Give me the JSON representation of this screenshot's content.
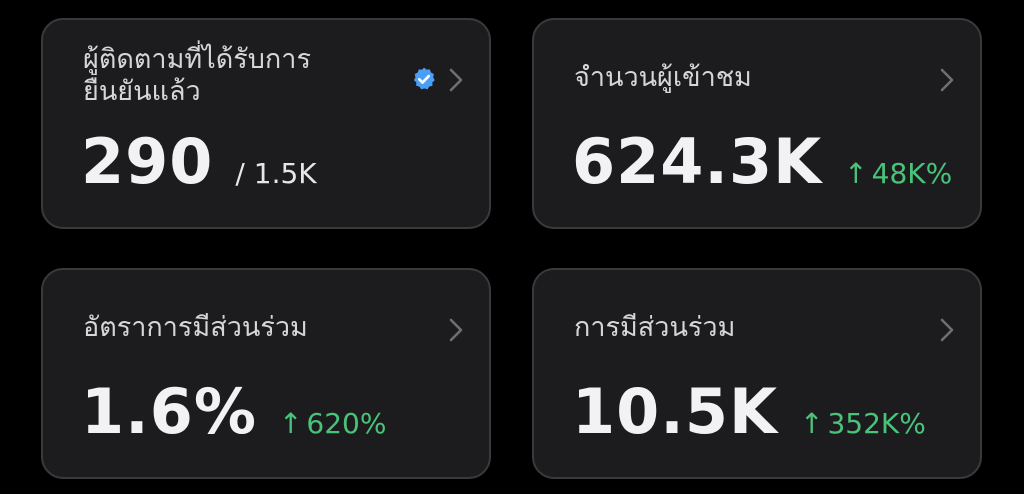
{
  "cards": [
    {
      "title": "ผู้ติดตามที่ได้รับการ\nยืนยันแล้ว",
      "value": "290",
      "secondary": "/ 1.5K",
      "verified_icon": "verified-badge-icon"
    },
    {
      "title": "จำนวนผู้เข้าชม",
      "value": "624.3K",
      "delta_arrow": "↑",
      "delta": "48K%"
    },
    {
      "title": "อัตราการมีส่วนร่วม",
      "value": "1.6%",
      "delta_arrow": "↑",
      "delta": "620%"
    },
    {
      "title": "การมีส่วนร่วม",
      "value": "10.5K",
      "delta_arrow": "↑",
      "delta": "352K%"
    }
  ],
  "colors": {
    "background": "#000000",
    "card_bg": "#1c1c1e",
    "card_border": "#3a3a3d",
    "value_text": "#f2f2f4",
    "title_text": "#d6d6d8",
    "delta_green": "#49c37a",
    "verified_blue": "#4a9ff5",
    "chevron": "#6e6e73"
  }
}
